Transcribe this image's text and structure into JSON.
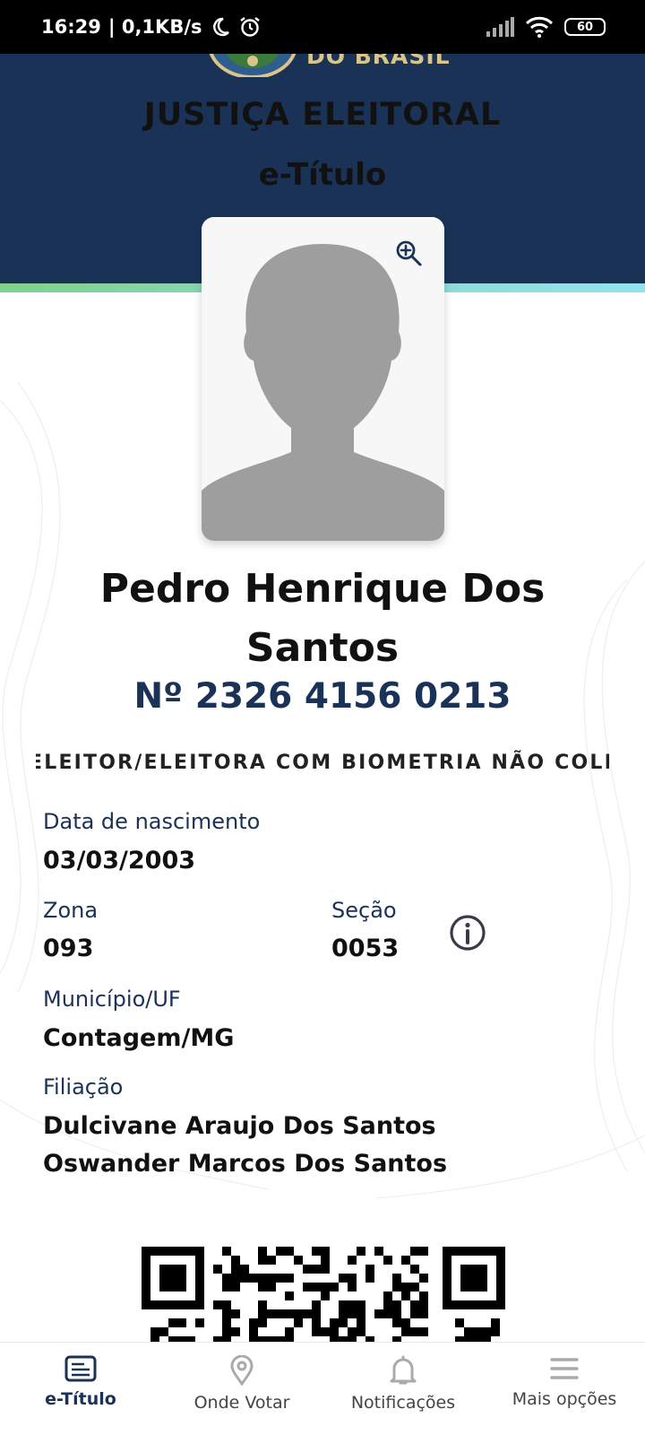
{
  "status_bar": {
    "time": "16:29",
    "speed": "| 0,1KB/s",
    "battery": "60",
    "icons": [
      "moon-icon",
      "alarm-icon",
      "signal-icon",
      "wifi-icon",
      "battery-icon"
    ]
  },
  "header": {
    "country_fragment": "DO BRASIL",
    "agency": "JUSTIÇA ELEITORAL",
    "app_title": "e-Título",
    "colors": {
      "header_bg": "#1b3257",
      "accent_band_start": "#7fd18a",
      "accent_band_end": "#92e3f0"
    }
  },
  "voter": {
    "name": "Pedro Henrique Dos Santos",
    "number": "Nº 2326 4156 0213",
    "biometric_status": "ELEITOR/ELEITORA COM BIOMETRIA NÃO COLETADA",
    "fields": {
      "birth_label": "Data de nascimento",
      "birth_value": "03/03/2003",
      "zone_label": "Zona",
      "zone_value": "093",
      "section_label": "Seção",
      "section_value": "0053",
      "city_label": "Município/UF",
      "city_value": "Contagem/MG",
      "parents_label": "Filiação",
      "parent_1": "Dulcivane Araujo Dos Santos",
      "parent_2": "Oswander Marcos Dos Santos"
    }
  },
  "bottom_nav": {
    "items": [
      {
        "label": "e-Título",
        "icon": "card-icon",
        "active": true
      },
      {
        "label": "Onde Votar",
        "icon": "location-pin-icon",
        "active": false
      },
      {
        "label": "Notificações",
        "icon": "bell-icon",
        "active": false
      },
      {
        "label": "Mais opções",
        "icon": "menu-icon",
        "active": false
      }
    ]
  }
}
